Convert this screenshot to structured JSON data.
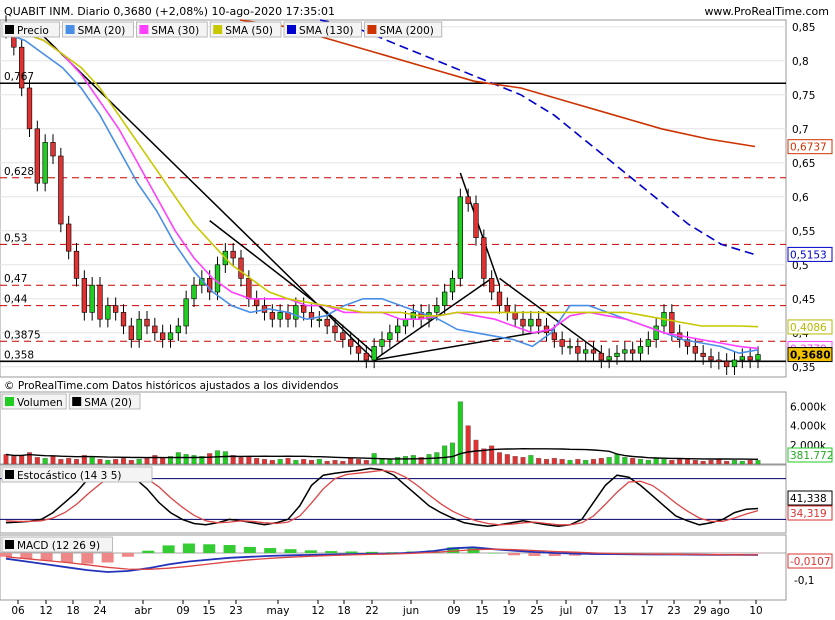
{
  "header": {
    "title": "QUABIT INM. Diario 0,3680 (+2,08%) 10-ago-2020 17:35:01",
    "site": "www.ProRealTime.com"
  },
  "legend": [
    {
      "label": "Precio",
      "color": "#000000",
      "kind": "price"
    },
    {
      "label": "SMA (20)",
      "color": "#4a8fe7"
    },
    {
      "label": "SMA (30)",
      "color": "#ff40ff"
    },
    {
      "label": "SMA (50)",
      "color": "#c8c800"
    },
    {
      "label": "SMA (130)",
      "color": "#0000cc"
    },
    {
      "label": "SMA (200)",
      "color": "#cc3300"
    }
  ],
  "copyright": "© ProRealTime.com  Datos históricos ajustados a los dividendos",
  "colors": {
    "up": "#22cc22",
    "down": "#dd3333",
    "support": "#cc0000",
    "grid": "#e3e3e3"
  },
  "price_panel": {
    "y_ticks": [
      "0,85",
      "0,8",
      "0,75",
      "0,7",
      "0,65",
      "0,6",
      "0,55",
      "0,5",
      "0,45",
      "0,4",
      "0,35"
    ],
    "level_labels": [
      {
        "text": "0,767",
        "value": 0.767
      },
      {
        "text": "0,628",
        "value": 0.628
      },
      {
        "text": "0,53",
        "value": 0.53
      },
      {
        "text": "0,47",
        "value": 0.47
      },
      {
        "text": "0,44",
        "value": 0.44
      },
      {
        "text": "0,3875",
        "value": 0.3875
      },
      {
        "text": "0,358",
        "value": 0.358
      }
    ],
    "value_badges": [
      {
        "text": "0,6737",
        "value": 0.6737,
        "color": "#cc3300"
      },
      {
        "text": "0,5153",
        "value": 0.5153,
        "color": "#0000cc"
      },
      {
        "text": "0,4086",
        "value": 0.4086,
        "color": "#b8b800"
      },
      {
        "text": "0,3770",
        "value": 0.377,
        "color": "#ff40ff"
      },
      {
        "text": "0,3680",
        "value": 0.368,
        "color": "#000000"
      }
    ]
  },
  "volume_panel": {
    "legend": [
      {
        "label": "Volumen",
        "color": "#22cc22"
      },
      {
        "label": "SMA (20)",
        "color": "#000000"
      }
    ],
    "y_ticks": [
      "6.000k",
      "4.000k",
      "2.000k"
    ],
    "badge": "381.772"
  },
  "stoch_panel": {
    "legend": [
      {
        "label": "Estocástico (14 3 5)",
        "color": "#000000"
      }
    ],
    "badges": [
      {
        "text": "41,338",
        "color": "#000000"
      },
      {
        "text": "34,319",
        "color": "#dd3333"
      }
    ]
  },
  "macd_panel": {
    "legend": [
      {
        "label": "MACD (12 26 9)",
        "color": "#000000"
      }
    ],
    "badges": [
      {
        "text": "-0,0107",
        "color": "#dd3333"
      }
    ],
    "y_ticks": [
      "-0,1"
    ]
  },
  "x_axis": [
    "06",
    "12",
    "18",
    "24",
    "abr",
    "09",
    "15",
    "23",
    "may",
    "12",
    "18",
    "22",
    "jun",
    "09",
    "15",
    "19",
    "25",
    "jul",
    "07",
    "13",
    "17",
    "23",
    "29",
    "ago",
    "10"
  ],
  "chart_data": {
    "type": "candlestick",
    "title": "QUABIT INM. Diario 0,3680 (+2,08%) 10-ago-2020 17:35:01",
    "ylim": [
      0.335,
      0.86
    ],
    "horizontal_levels": [
      0.767,
      0.628,
      0.53,
      0.47,
      0.44,
      0.3875,
      0.358
    ],
    "close": [
      0.845,
      0.82,
      0.76,
      0.7,
      0.62,
      0.68,
      0.66,
      0.56,
      0.52,
      0.48,
      0.43,
      0.47,
      0.42,
      0.44,
      0.43,
      0.41,
      0.39,
      0.42,
      0.41,
      0.4,
      0.39,
      0.4,
      0.41,
      0.45,
      0.47,
      0.48,
      0.46,
      0.5,
      0.52,
      0.51,
      0.48,
      0.45,
      0.44,
      0.43,
      0.42,
      0.43,
      0.42,
      0.44,
      0.43,
      0.42,
      0.42,
      0.41,
      0.4,
      0.39,
      0.38,
      0.37,
      0.36,
      0.38,
      0.39,
      0.4,
      0.41,
      0.42,
      0.43,
      0.42,
      0.43,
      0.44,
      0.46,
      0.48,
      0.6,
      0.59,
      0.54,
      0.48,
      0.46,
      0.44,
      0.43,
      0.42,
      0.41,
      0.42,
      0.41,
      0.4,
      0.39,
      0.38,
      0.38,
      0.37,
      0.375,
      0.37,
      0.36,
      0.365,
      0.37,
      0.375,
      0.37,
      0.38,
      0.39,
      0.41,
      0.43,
      0.4,
      0.39,
      0.38,
      0.37,
      0.365,
      0.36,
      0.358,
      0.35,
      0.36,
      0.365,
      0.36,
      0.368
    ],
    "series": [
      {
        "name": "SMA (20)",
        "values": [
          0.84,
          0.83,
          0.81,
          0.79,
          0.76,
          0.72,
          0.67,
          0.62,
          0.58,
          0.53,
          0.49,
          0.46,
          0.44,
          0.43,
          0.435,
          0.43,
          0.42,
          0.425,
          0.44,
          0.45,
          0.45,
          0.44,
          0.43,
          0.42,
          0.405,
          0.4,
          0.395,
          0.39,
          0.38,
          0.4,
          0.44,
          0.44,
          0.43,
          0.42,
          0.41,
          0.4,
          0.39,
          0.385,
          0.38,
          0.37,
          0.375
        ]
      },
      {
        "name": "SMA (30)",
        "values": [
          0.85,
          0.84,
          0.83,
          0.81,
          0.78,
          0.74,
          0.7,
          0.65,
          0.6,
          0.55,
          0.51,
          0.48,
          0.46,
          0.45,
          0.45,
          0.45,
          0.44,
          0.44,
          0.43,
          0.43,
          0.43,
          0.42,
          0.42,
          0.425,
          0.43,
          0.425,
          0.42,
          0.41,
          0.4,
          0.405,
          0.425,
          0.43,
          0.425,
          0.42,
          0.41,
          0.4,
          0.395,
          0.39,
          0.385,
          0.38,
          0.377
        ]
      },
      {
        "name": "SMA (50)",
        "values": [
          0.85,
          0.84,
          0.83,
          0.81,
          0.79,
          0.76,
          0.72,
          0.68,
          0.64,
          0.6,
          0.56,
          0.53,
          0.5,
          0.48,
          0.46,
          0.45,
          0.445,
          0.44,
          0.435,
          0.43,
          0.43,
          0.43,
          0.425,
          0.425,
          0.43,
          0.43,
          0.43,
          0.43,
          0.43,
          0.43,
          0.43,
          0.43,
          0.43,
          0.43,
          0.425,
          0.42,
          0.415,
          0.41,
          0.41,
          0.41,
          0.409
        ]
      },
      {
        "name": "SMA (130)",
        "values": [
          0.86,
          0.85,
          0.83,
          0.81,
          0.79,
          0.77,
          0.75,
          0.72,
          0.68,
          0.64,
          0.6,
          0.56,
          0.53,
          0.515
        ]
      },
      {
        "name": "SMA (200)",
        "values": [
          0.86,
          0.85,
          0.83,
          0.81,
          0.79,
          0.77,
          0.76,
          0.74,
          0.72,
          0.7,
          0.685,
          0.674
        ]
      }
    ],
    "volume": [
      1.0,
      0.8,
      0.9,
      1.2,
      0.7,
      0.6,
      0.8,
      0.5,
      0.6,
      0.5,
      0.9,
      0.7,
      0.5,
      0.4,
      0.5,
      0.6,
      0.4,
      0.5,
      0.6,
      0.9,
      0.7,
      0.8,
      1.2,
      1.0,
      0.9,
      0.8,
      1.1,
      1.4,
      1.3,
      0.9,
      0.7,
      0.8,
      0.6,
      0.5,
      0.4,
      0.5,
      0.6,
      0.4,
      0.5,
      0.4,
      0.5,
      0.3,
      0.4,
      0.3,
      0.6,
      0.5,
      0.4,
      1.1,
      0.6,
      0.5,
      0.7,
      0.8,
      0.9,
      0.7,
      1.0,
      1.2,
      1.9,
      2.2,
      6.5,
      4.0,
      2.5,
      1.6,
      1.9,
      1.2,
      1.0,
      0.8,
      0.7,
      0.9,
      0.6,
      0.5,
      0.6,
      0.5,
      0.4,
      0.5,
      0.4,
      0.5,
      0.6,
      0.7,
      1.0,
      0.7,
      0.6,
      0.5,
      0.4,
      0.6,
      0.5,
      0.4,
      0.5,
      0.6,
      0.4,
      0.3,
      0.4,
      0.5,
      0.3,
      0.4,
      0.3,
      0.4,
      0.38
    ]
  }
}
